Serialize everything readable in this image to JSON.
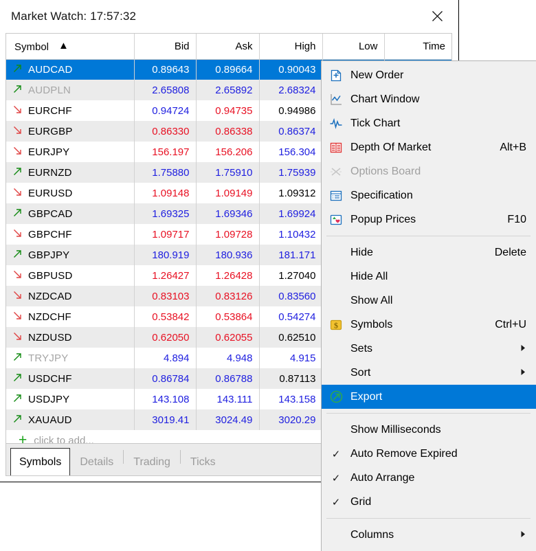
{
  "window": {
    "title": "Market Watch: 17:57:32",
    "close_label": "close-window"
  },
  "table": {
    "columns": [
      "Symbol",
      "Bid",
      "Ask",
      "High",
      "Low",
      "Time"
    ],
    "sort_column": "Symbol",
    "sort_caret": "▲",
    "add_row_label": "click to add...",
    "add_row_plus": "+",
    "rows": [
      {
        "dir": "up",
        "symbol": "AUDCAD",
        "bid": "0.89643",
        "ask": "0.89664",
        "high": "0.90043",
        "bid_c": "up",
        "ask_c": "up",
        "high_c": "up",
        "selected": true,
        "dim": false
      },
      {
        "dir": "up",
        "symbol": "AUDPLN",
        "bid": "2.65808",
        "ask": "2.65892",
        "high": "2.68324",
        "bid_c": "up",
        "ask_c": "up",
        "high_c": "up",
        "selected": false,
        "dim": true
      },
      {
        "dir": "down",
        "symbol": "EURCHF",
        "bid": "0.94724",
        "ask": "0.94735",
        "high": "0.94986",
        "bid_c": "up",
        "ask_c": "down",
        "high_c": "flat",
        "selected": false,
        "dim": false
      },
      {
        "dir": "down",
        "symbol": "EURGBP",
        "bid": "0.86330",
        "ask": "0.86338",
        "high": "0.86374",
        "bid_c": "down",
        "ask_c": "down",
        "high_c": "up",
        "selected": false,
        "dim": false
      },
      {
        "dir": "down",
        "symbol": "EURJPY",
        "bid": "156.197",
        "ask": "156.206",
        "high": "156.304",
        "bid_c": "down",
        "ask_c": "down",
        "high_c": "up",
        "selected": false,
        "dim": false
      },
      {
        "dir": "up",
        "symbol": "EURNZD",
        "bid": "1.75880",
        "ask": "1.75910",
        "high": "1.75939",
        "bid_c": "up",
        "ask_c": "up",
        "high_c": "up",
        "selected": false,
        "dim": false
      },
      {
        "dir": "down",
        "symbol": "EURUSD",
        "bid": "1.09148",
        "ask": "1.09149",
        "high": "1.09312",
        "bid_c": "down",
        "ask_c": "down",
        "high_c": "flat",
        "selected": false,
        "dim": false
      },
      {
        "dir": "up",
        "symbol": "GBPCAD",
        "bid": "1.69325",
        "ask": "1.69346",
        "high": "1.69924",
        "bid_c": "up",
        "ask_c": "up",
        "high_c": "up",
        "selected": false,
        "dim": false
      },
      {
        "dir": "down",
        "symbol": "GBPCHF",
        "bid": "1.09717",
        "ask": "1.09728",
        "high": "1.10432",
        "bid_c": "down",
        "ask_c": "down",
        "high_c": "up",
        "selected": false,
        "dim": false
      },
      {
        "dir": "up",
        "symbol": "GBPJPY",
        "bid": "180.919",
        "ask": "180.936",
        "high": "181.171",
        "bid_c": "up",
        "ask_c": "up",
        "high_c": "up",
        "selected": false,
        "dim": false
      },
      {
        "dir": "down",
        "symbol": "GBPUSD",
        "bid": "1.26427",
        "ask": "1.26428",
        "high": "1.27040",
        "bid_c": "down",
        "ask_c": "down",
        "high_c": "flat",
        "selected": false,
        "dim": false
      },
      {
        "dir": "down",
        "symbol": "NZDCAD",
        "bid": "0.83103",
        "ask": "0.83126",
        "high": "0.83560",
        "bid_c": "down",
        "ask_c": "down",
        "high_c": "up",
        "selected": false,
        "dim": false
      },
      {
        "dir": "down",
        "symbol": "NZDCHF",
        "bid": "0.53842",
        "ask": "0.53864",
        "high": "0.54274",
        "bid_c": "down",
        "ask_c": "down",
        "high_c": "up",
        "selected": false,
        "dim": false
      },
      {
        "dir": "down",
        "symbol": "NZDUSD",
        "bid": "0.62050",
        "ask": "0.62055",
        "high": "0.62510",
        "bid_c": "down",
        "ask_c": "down",
        "high_c": "flat",
        "selected": false,
        "dim": false
      },
      {
        "dir": "up",
        "symbol": "TRYJPY",
        "bid": "4.894",
        "ask": "4.948",
        "high": "4.915",
        "bid_c": "up",
        "ask_c": "up",
        "high_c": "up",
        "selected": false,
        "dim": true
      },
      {
        "dir": "up",
        "symbol": "USDCHF",
        "bid": "0.86784",
        "ask": "0.86788",
        "high": "0.87113",
        "bid_c": "up",
        "ask_c": "up",
        "high_c": "flat",
        "selected": false,
        "dim": false
      },
      {
        "dir": "up",
        "symbol": "USDJPY",
        "bid": "143.108",
        "ask": "143.111",
        "high": "143.158",
        "bid_c": "up",
        "ask_c": "up",
        "high_c": "up",
        "selected": false,
        "dim": false
      },
      {
        "dir": "up",
        "symbol": "XAUAUD",
        "bid": "3019.41",
        "ask": "3024.49",
        "high": "3020.29",
        "bid_c": "up",
        "ask_c": "up",
        "high_c": "up",
        "selected": false,
        "dim": false
      }
    ]
  },
  "tabs": [
    {
      "label": "Symbols",
      "active": true
    },
    {
      "label": "Details",
      "active": false
    },
    {
      "label": "Trading",
      "active": false
    },
    {
      "label": "Ticks",
      "active": false
    }
  ],
  "context_menu": {
    "items": [
      {
        "label": "New Order",
        "icon": "new-order-icon",
        "accel": "",
        "type": "item"
      },
      {
        "label": "Chart Window",
        "icon": "chart-window-icon",
        "accel": "",
        "type": "item"
      },
      {
        "label": "Tick Chart",
        "icon": "tick-chart-icon",
        "accel": "",
        "type": "item"
      },
      {
        "label": "Depth Of Market",
        "icon": "depth-of-market-icon",
        "accel": "Alt+B",
        "type": "item"
      },
      {
        "label": "Options Board",
        "icon": "options-board-icon",
        "accel": "",
        "type": "item",
        "disabled": true
      },
      {
        "label": "Specification",
        "icon": "specification-icon",
        "accel": "",
        "type": "item"
      },
      {
        "label": "Popup Prices",
        "icon": "popup-prices-icon",
        "accel": "F10",
        "type": "item"
      },
      {
        "type": "separator"
      },
      {
        "label": "Hide",
        "icon": "",
        "accel": "Delete",
        "type": "item"
      },
      {
        "label": "Hide All",
        "icon": "",
        "accel": "",
        "type": "item"
      },
      {
        "label": "Show All",
        "icon": "",
        "accel": "",
        "type": "item"
      },
      {
        "label": "Symbols",
        "icon": "symbols-icon",
        "accel": "Ctrl+U",
        "type": "item"
      },
      {
        "label": "Sets",
        "icon": "",
        "accel": "",
        "type": "submenu"
      },
      {
        "label": "Sort",
        "icon": "",
        "accel": "",
        "type": "submenu"
      },
      {
        "label": "Export",
        "icon": "export-icon",
        "accel": "",
        "type": "item",
        "selected": true
      },
      {
        "type": "separator"
      },
      {
        "label": "Show Milliseconds",
        "icon": "",
        "accel": "",
        "type": "checkitem",
        "checked": false
      },
      {
        "label": "Auto Remove Expired",
        "icon": "",
        "accel": "",
        "type": "checkitem",
        "checked": true
      },
      {
        "label": "Auto Arrange",
        "icon": "",
        "accel": "",
        "type": "checkitem",
        "checked": true
      },
      {
        "label": "Grid",
        "icon": "",
        "accel": "",
        "type": "checkitem",
        "checked": true
      },
      {
        "type": "separator"
      },
      {
        "label": "Columns",
        "icon": "",
        "accel": "",
        "type": "submenu"
      }
    ],
    "check_glyph": "✓",
    "submenu_glyph": "▶"
  },
  "colors": {
    "accent": "#0078d7",
    "price_up": "#2020e0",
    "price_down": "#e81123",
    "arrow_up": "#128a12",
    "arrow_down": "#e04343"
  }
}
